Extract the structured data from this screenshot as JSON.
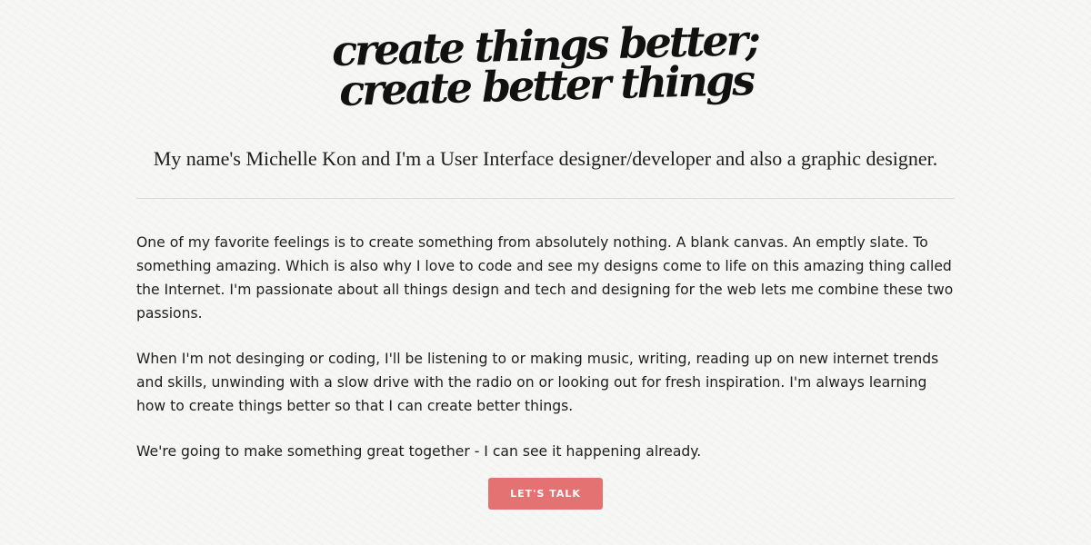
{
  "hero": {
    "logo_line1": "create things better;",
    "logo_line2": "create better things",
    "tagline": "My name's Michelle Kon and I'm a User Interface designer/developer and also a graphic designer."
  },
  "about": {
    "paragraphs": [
      "One of my favorite feelings is to create something from absolutely nothing. A blank canvas. An emptly slate. To something amazing. Which is also why I love to code and see my designs come to life on this amazing thing called the Internet. I'm passionate about all things design and tech and designing for the web lets me combine these two passions.",
      "When I'm not desinging or coding, I'll be listening to or making music, writing, reading up on new internet trends and skills, unwinding with a slow drive with the radio on or looking out for fresh inspiration. I'm always learning how to create things better so that I can create better things.",
      "We're going to make something great together - I can see it happening already."
    ]
  },
  "cta": {
    "label": "LET'S TALK"
  },
  "colors": {
    "background": "#f6f6f5",
    "accent": "#e47272",
    "text": "#1e1e1e",
    "divider": "#dcdcdc"
  }
}
